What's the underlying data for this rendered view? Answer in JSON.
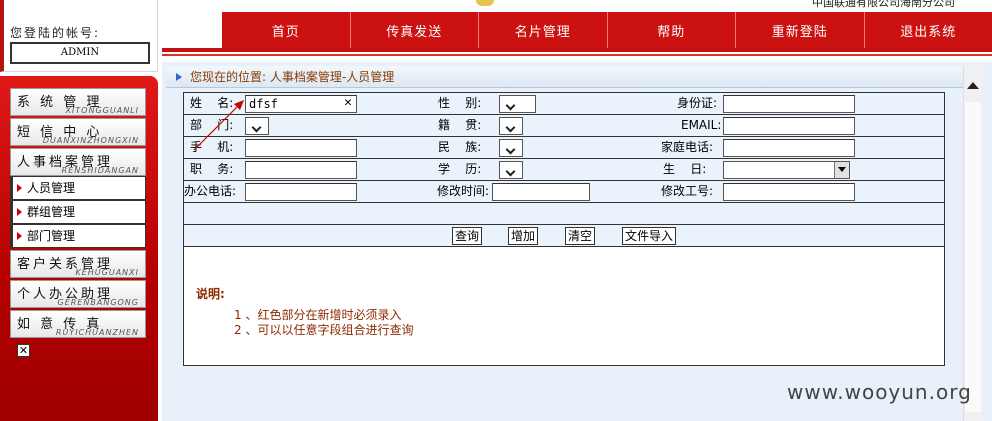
{
  "header": {
    "corner_text": "中国联通有限公司海南分公司"
  },
  "nav": {
    "items": [
      "首页",
      "传真发送",
      "名片管理",
      "帮助",
      "重新登陆",
      "退出系统"
    ]
  },
  "sidebar": {
    "account_label": "您登陆的帐号:",
    "account_value": "ADMIN",
    "menu": [
      {
        "label": "系 统 管 理",
        "pinyin": "XITONGGUANLI"
      },
      {
        "label": "短 信 中 心",
        "pinyin": "DUANXINZHONGXIN"
      },
      {
        "label": "人事档案管理",
        "pinyin": "RENSHIDANGAN"
      },
      {
        "label": "客户关系管理",
        "pinyin": "KEHUGUANXI"
      },
      {
        "label": "个人办公助理",
        "pinyin": "GERENBANGONG"
      },
      {
        "label": "如 意 传 真",
        "pinyin": "RUYICHUANZHEN"
      }
    ],
    "submenu": [
      "人员管理",
      "群组管理",
      "部门管理"
    ],
    "close_glyph": "✕"
  },
  "breadcrumb": {
    "text": "您现在的位置: 人事档案管理-人员管理"
  },
  "form": {
    "rows": [
      [
        {
          "label": "姓    名:",
          "value": "dfsf"
        },
        {
          "label": "性    别:"
        },
        {
          "label": "身份证:"
        }
      ],
      [
        {
          "label": "部    门:"
        },
        {
          "label": "籍    贯:"
        },
        {
          "label": "EMAIL:"
        }
      ],
      [
        {
          "label": "手    机:"
        },
        {
          "label": "民    族:"
        },
        {
          "label": "家庭电话:"
        }
      ],
      [
        {
          "label": "职    务:"
        },
        {
          "label": "学    历:"
        },
        {
          "label": "生    日:"
        }
      ],
      [
        {
          "label": "办公电话:"
        },
        {
          "label": "修改时间:"
        },
        {
          "label": "修改工号:"
        }
      ]
    ],
    "clear_glyph": "✕"
  },
  "buttons": {
    "query": "查询",
    "add": "增加",
    "clear": "清空",
    "import": "文件导入"
  },
  "notes": {
    "title": "说明:",
    "lines": [
      "1 、红色部分在新增时必须录入",
      "2 、可以以任意字段组合进行查询"
    ]
  },
  "watermark": "www.wooyun.org"
}
